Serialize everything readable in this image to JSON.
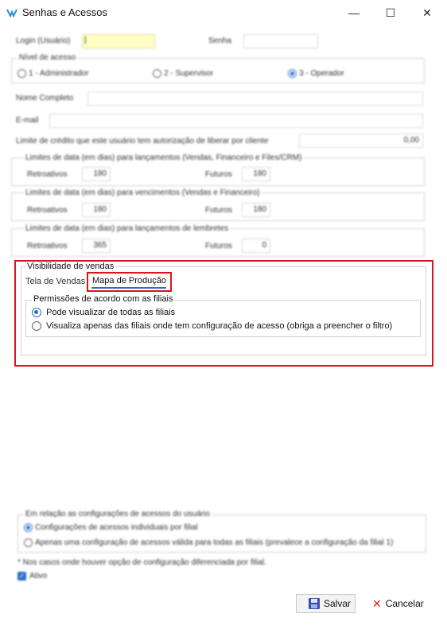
{
  "window": {
    "title": "Senhas e Acessos",
    "minimize": "—",
    "maximize": "☐",
    "close": "✕"
  },
  "login": {
    "label": "Login (Usuário)",
    "value": "|"
  },
  "senha": {
    "label": "Senha",
    "value": ""
  },
  "nivel": {
    "title": "Nível de acesso",
    "options": [
      "1 - Administrador",
      "2 - Supervisor",
      "3 - Operador"
    ],
    "selected": 2
  },
  "nome_completo": {
    "label": "Nome Completo",
    "value": ""
  },
  "email": {
    "label": "E-mail",
    "value": ""
  },
  "credito": {
    "label": "Limite de crédito que este usuário tem autorização de liberar por cliente",
    "value": "0,00"
  },
  "limites": [
    {
      "title": "Limites de data (em dias) para lançamentos (Vendas, Financeiro e Files/CRM)",
      "retro_label": "Retroativos",
      "retro": "180",
      "fut_label": "Futuros",
      "fut": "180"
    },
    {
      "title": "Limites de data (em dias) para vencimentos (Vendas e Financeiro)",
      "retro_label": "Retroativos",
      "retro": "180",
      "fut_label": "Futuros",
      "fut": "180"
    },
    {
      "title": "Limites de data (em dias) para lançamentos de lembretes",
      "retro_label": "Retroativos",
      "retro": "365",
      "fut_label": "Futuros",
      "fut": "0"
    }
  ],
  "visibilidade": {
    "title": "Visibilidade de vendas",
    "tabs": [
      "Tela de Vendas",
      "Mapa de Produção"
    ],
    "active_tab": 1,
    "permissoes": {
      "title": "Permissões de acordo com as filiais",
      "options": [
        "Pode visualizar de todas as filiais",
        "Visualiza apenas das filiais onde tem configuração de acesso (obriga a preencher o filtro)"
      ],
      "selected": 0
    }
  },
  "config": {
    "title": "Em relação as configurações de acessos do usuário",
    "options": [
      "Configurações de acessos individuais por filial",
      "Apenas uma configuração de acessos válida para todas as filiais (prevalece a configuração da filial 1)"
    ],
    "selected": 0
  },
  "note": "* Nos casos onde houver opção de configuração diferenciada por filial.",
  "ativo": {
    "label": "Ativo",
    "checked": true
  },
  "buttons": {
    "salvar": "Salvar",
    "cancelar": "Cancelar"
  },
  "colors": {
    "accent": "#2a6fc9",
    "highlight": "#d9141c",
    "login_bg": "#ffffc4"
  }
}
